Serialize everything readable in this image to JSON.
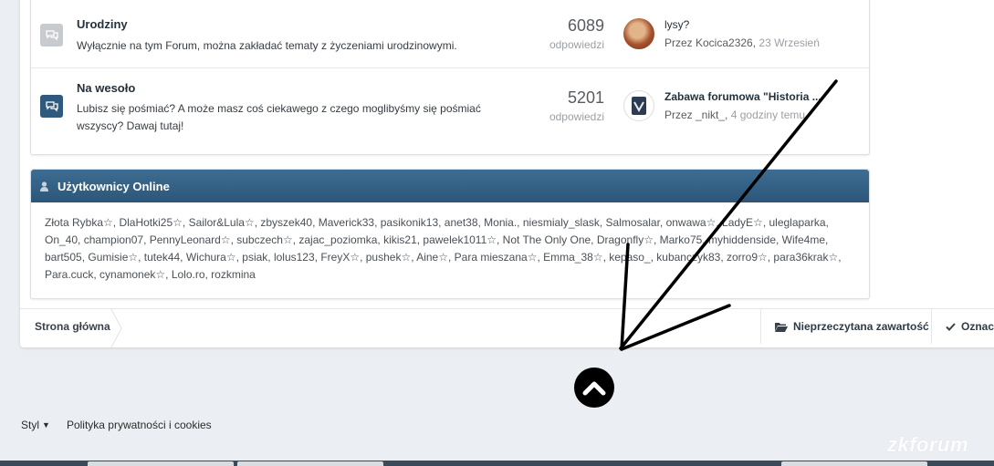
{
  "forums": [
    {
      "title": "Urodziny",
      "description": "Wyłącznie na tym Forum, można zakładać tematy z życzeniami urodzinowymi.",
      "count": "6089",
      "count_label": "odpowiedzi",
      "last_post_title": "lysy?",
      "last_post_by": "Przez Kocica2326,",
      "last_post_time": "23 Wrzesień",
      "icon": "chat-bubbles-icon",
      "status": "read"
    },
    {
      "title": "Na wesoło",
      "description": "Lubisz się pośmiać? A może masz coś ciekawego z czego moglibyśmy się pośmiać wszyscy? Dawaj tutaj!",
      "count": "5201",
      "count_label": "odpowiedzi",
      "last_post_title": "Zabawa forumowa \"Historia ...",
      "last_post_by": "Przez _nikt_,",
      "last_post_time": "4 godziny temu",
      "icon": "chat-bubbles-icon",
      "status": "unread"
    }
  ],
  "online": {
    "title": "Użytkownicy Online",
    "users": "Złota Rybka☆, DlaHotki25☆, Sailor&Lula☆, zbyszek40, Maverick33, pasikonik13, anet38, Monia., niesmialy_slask, Salmosalar, onwawa☆, LadyE☆, uleglaparka, On_40, champion07, PennyLeonard☆, subczech☆, zajac_poziomka, kikis21, pawelek1011☆, Not The Only One, Dragonfly☆, Marko75, myhiddenside, Wife4me, bart505, Gumisie☆, tutek44, Wichura☆, psiak, lolus123, FreyX☆, pushek☆, Aine☆, Para mieszana☆, Emma_38☆, kepaso_, kubanczyk83, zorro9☆, para36krak☆, Para.cuck, cynamonek☆, Lolo.ro, rozkmina"
  },
  "breadcrumb": {
    "home": "Strona główna"
  },
  "quick_links": {
    "unread": "Nieprzeczytana zawartość",
    "mark": "Oznacz"
  },
  "footer": {
    "style": "Styl",
    "privacy": "Polityka prywatności i cookies"
  },
  "watermark": "zkforum",
  "colors": {
    "header_blue": "#2f5a7d",
    "page_bg": "#ebeef2",
    "annotation": "#000000"
  }
}
